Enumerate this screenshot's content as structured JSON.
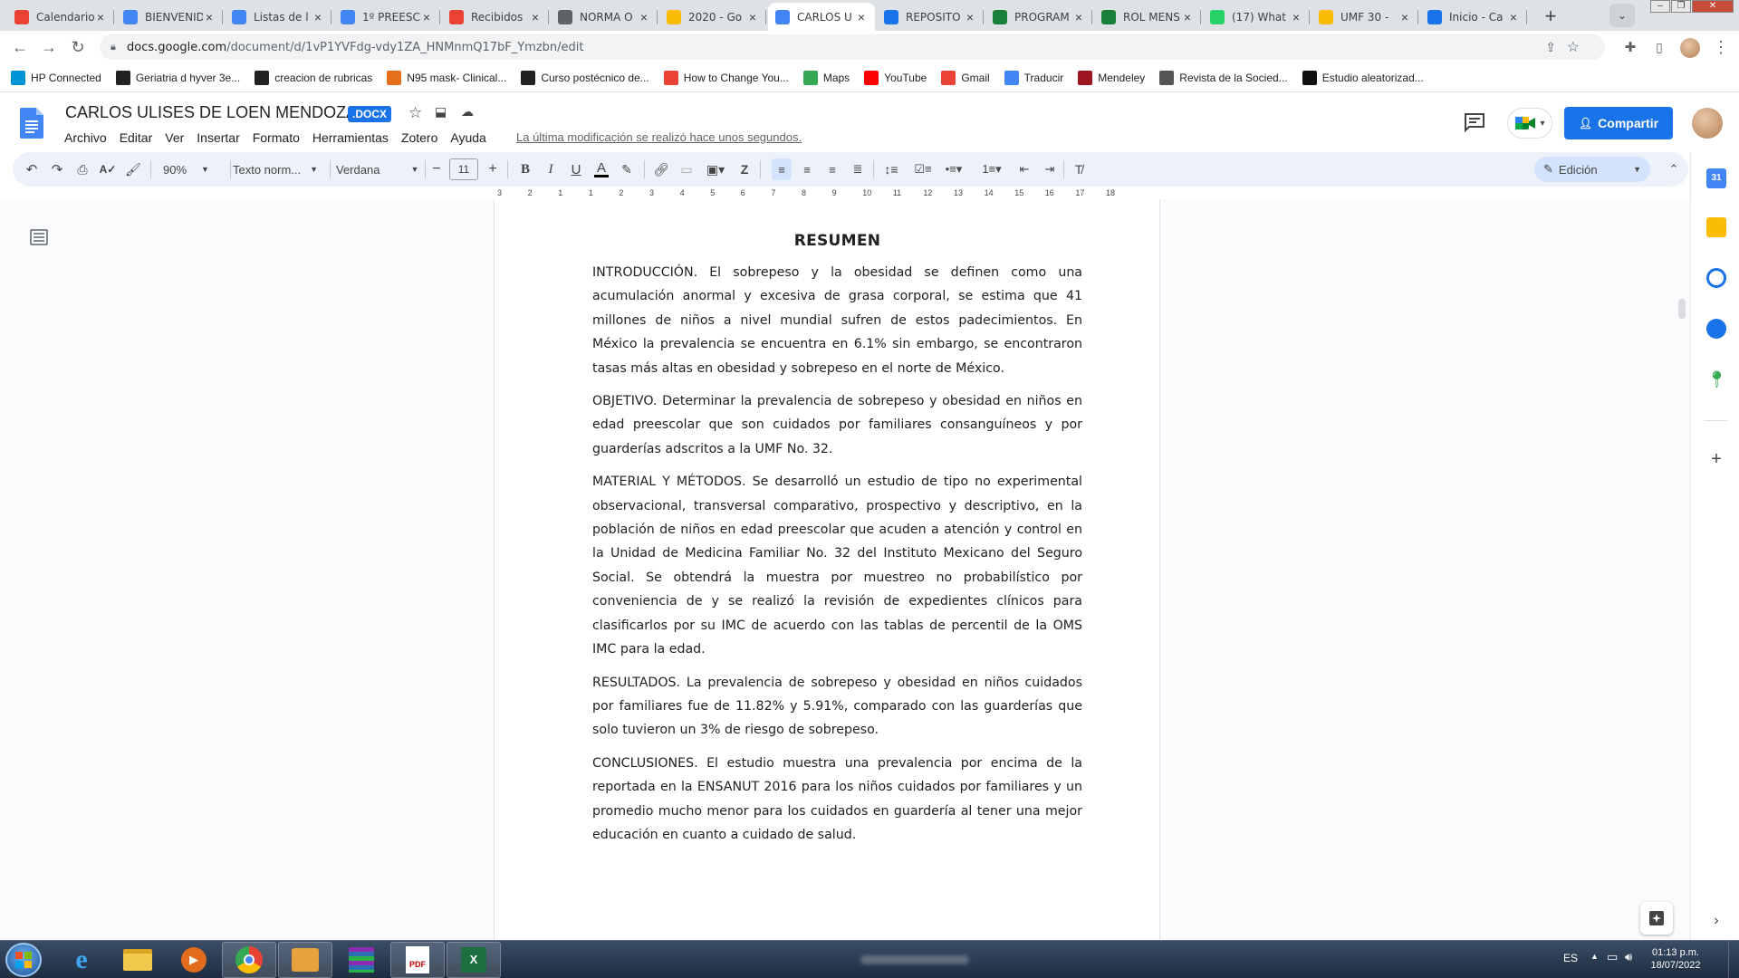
{
  "browser": {
    "tabs": [
      {
        "title": "Calendario",
        "icon": "gmail-icon",
        "color": "#ea4335"
      },
      {
        "title": "BIENVENID",
        "icon": "docs-icon",
        "color": "#4285f4"
      },
      {
        "title": "Listas de l",
        "icon": "docs-icon",
        "color": "#4285f4"
      },
      {
        "title": "1º PREESC",
        "icon": "docs-icon",
        "color": "#4285f4"
      },
      {
        "title": "Recibidos",
        "icon": "gmail-icon",
        "color": "#ea4335"
      },
      {
        "title": "NORMA O",
        "icon": "globe-icon",
        "color": "#5f6368"
      },
      {
        "title": "2020 - Go",
        "icon": "drive-icon",
        "color": "#fbbc04"
      },
      {
        "title": "CARLOS U",
        "icon": "docs-icon",
        "color": "#4285f4"
      },
      {
        "title": "REPOSITO",
        "icon": "chrome-c-icon",
        "color": "#1a73e8"
      },
      {
        "title": "PROGRAM",
        "icon": "sheets-icon",
        "color": "#188038"
      },
      {
        "title": "ROL MENS",
        "icon": "sheets-icon",
        "color": "#188038"
      },
      {
        "title": "(17) What",
        "icon": "whatsapp-icon",
        "color": "#25d366"
      },
      {
        "title": "UMF 30 -",
        "icon": "drive-icon",
        "color": "#fbbc04"
      },
      {
        "title": "Inicio - Ca",
        "icon": "chrome-c-icon",
        "color": "#1a73e8"
      }
    ],
    "active_tab_index": 7,
    "new_tab_label": "+",
    "url_host": "docs.google.com",
    "url_path": "/document/d/1vP1YVFdg-vdy1ZA_HNMnmQ17bF_Ymzbn/edit",
    "bookmarks": [
      {
        "label": "HP Connected",
        "icon": "hp-icon",
        "color": "#0096d6"
      },
      {
        "label": "Geriatria d hyver 3e...",
        "icon": "a-icon",
        "color": "#222"
      },
      {
        "label": "creacion de rubricas",
        "icon": "rubric-icon",
        "color": "#222"
      },
      {
        "label": "N95 mask- Clinical...",
        "icon": "ck-icon",
        "color": "#e66f1c"
      },
      {
        "label": "Curso postécnico de...",
        "icon": "s-icon",
        "color": "#222"
      },
      {
        "label": "How to Change You...",
        "icon": "gmail-icon",
        "color": "#ea4335"
      },
      {
        "label": "Maps",
        "icon": "maps-icon",
        "color": "#34a853"
      },
      {
        "label": "YouTube",
        "icon": "youtube-icon",
        "color": "#ff0000"
      },
      {
        "label": "Gmail",
        "icon": "gmail-icon",
        "color": "#ea4335"
      },
      {
        "label": "Traducir",
        "icon": "translate-icon",
        "color": "#4285f4"
      },
      {
        "label": "Mendeley",
        "icon": "mendeley-icon",
        "color": "#9d1620"
      },
      {
        "label": "Revista de la Socied...",
        "icon": "figure-icon",
        "color": "#555"
      },
      {
        "label": "Estudio aleatorizad...",
        "icon": "w-icon",
        "color": "#111"
      }
    ]
  },
  "docs": {
    "title": "CARLOS ULISES DE LOEN MENDOZA",
    "badge": ".DOCX",
    "menus": [
      "Archivo",
      "Editar",
      "Ver",
      "Insertar",
      "Formato",
      "Herramientas",
      "Zotero",
      "Ayuda"
    ],
    "last_edit": "La última modificación se realizó hace unos segundos.",
    "share_label": "Compartir",
    "toolbar": {
      "zoom": "90%",
      "style": "Texto norm...",
      "font": "Verdana",
      "font_size": "11",
      "mode": "Edición"
    },
    "ruler_marks": [
      "3",
      "2",
      "1",
      "1",
      "2",
      "3",
      "4",
      "5",
      "6",
      "7",
      "8",
      "9",
      "10",
      "11",
      "12",
      "13",
      "14",
      "15",
      "16",
      "17",
      "18"
    ]
  },
  "document": {
    "heading": "RESUMEN",
    "paragraphs": [
      "INTRODUCCIÓN. El sobrepeso y la obesidad se definen como una acumulación anormal y excesiva de grasa corporal, se estima que 41 millones de niños a nivel mundial sufren de estos padecimientos. En México la prevalencia se encuentra en 6.1% sin embargo, se encontraron tasas más altas en obesidad y sobrepeso en el norte de México.",
      "OBJETIVO. Determinar la prevalencia de sobrepeso y obesidad en niños en edad preescolar que son cuidados por familiares consanguíneos y por guarderías adscritos a la UMF No. 32.",
      "MATERIAL Y MÉTODOS. Se desarrolló un estudio de tipo no experimental observacional, transversal comparativo, prospectivo y descriptivo, en la población de niños en edad preescolar que acuden a atención y control en la Unidad de Medicina Familiar No. 32 del Instituto Mexicano del Seguro Social. Se obtendrá la muestra por muestreo no probabilístico por conveniencia de y se realizó la revisión de expedientes clínicos para clasificarlos por su IMC de acuerdo con las tablas de percentil de la OMS IMC para la edad.",
      "RESULTADOS. La prevalencia de sobrepeso y obesidad en niños cuidados por familiares fue de 11.82% y 5.91%, comparado con las guarderías que solo tuvieron un 3% de riesgo de sobrepeso.",
      "CONCLUSIONES. El estudio muestra una prevalencia por encima de la reportada en la ENSANUT 2016 para los niños cuidados por familiares y un promedio mucho menor para los cuidados en guardería al tener una mejor educación en cuanto a cuidado de salud."
    ]
  },
  "taskbar": {
    "lang": "ES",
    "time": "01:13 p.m.",
    "date": "18/07/2022"
  }
}
